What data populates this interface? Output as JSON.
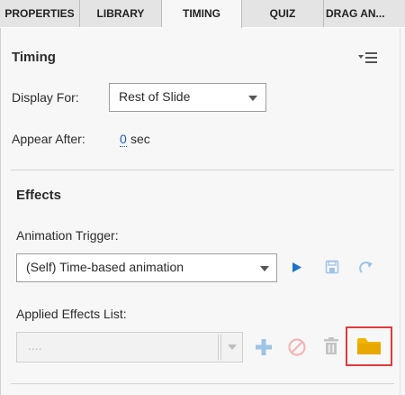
{
  "tabs": [
    {
      "label": "PROPERTIES"
    },
    {
      "label": "LIBRARY"
    },
    {
      "label": "TIMING"
    },
    {
      "label": "QUIZ"
    },
    {
      "label": "DRAG AN..."
    }
  ],
  "timing": {
    "title": "Timing",
    "display_for_label": "Display For:",
    "display_for_value": "Rest of Slide",
    "appear_after_label": "Appear After:",
    "appear_after_value": "0",
    "appear_after_unit": "sec"
  },
  "effects": {
    "title": "Effects",
    "trigger_label": "Animation Trigger:",
    "trigger_value": "(Self) Time-based animation",
    "applied_label": "Applied Effects List:",
    "applied_placeholder": "...."
  },
  "colors": {
    "accent_blue": "#1a73c9",
    "folder_yellow": "#f0b400",
    "highlight_red": "#e03a3a"
  }
}
